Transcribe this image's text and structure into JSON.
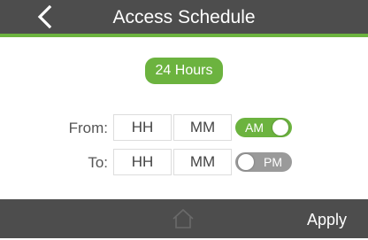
{
  "header": {
    "back_icon": "chevron-left-icon",
    "title": "Access Schedule",
    "accent_color": "#6cb33f",
    "background_color": "#4d4d4d"
  },
  "schedule": {
    "all_day_label": "24 Hours",
    "from": {
      "label": "From:",
      "hour_placeholder": "HH",
      "minute_placeholder": "MM",
      "period": "AM",
      "period_toggle_on": true
    },
    "to": {
      "label": "To:",
      "hour_placeholder": "HH",
      "minute_placeholder": "MM",
      "period": "PM",
      "period_toggle_on": false
    }
  },
  "footer": {
    "home_icon": "home-icon",
    "apply_label": "Apply"
  }
}
